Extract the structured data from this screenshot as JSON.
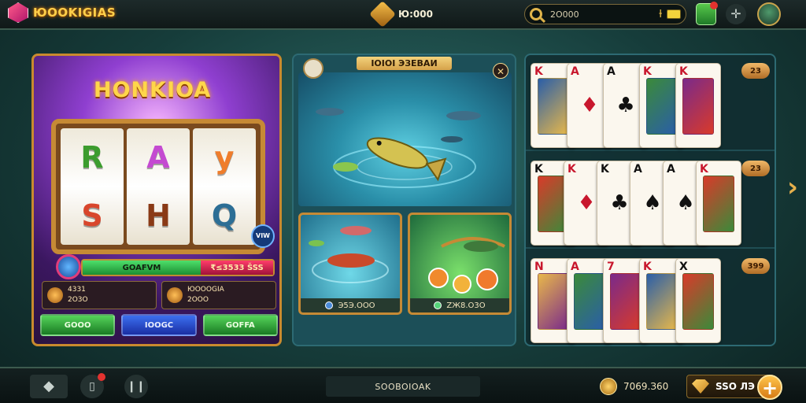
{
  "topbar": {
    "logo_text": "ЮOOKIGIAS",
    "jackpot_value": "Ю:000",
    "search_value": "2O000",
    "flag_glyph": "ƚ"
  },
  "slot": {
    "title": "HONKIOA",
    "reels": [
      [
        "R",
        "S"
      ],
      [
        "A",
        "H"
      ],
      [
        "y",
        "Q"
      ]
    ],
    "reel_colors": [
      "#3c9c2e",
      "#d8462c",
      "#c44ad1",
      "#8a3a16",
      "#ef7d2b",
      "#2c6e95"
    ],
    "badge": "VIW",
    "balance_left": "GOAFVM",
    "balance_right": "₹≤3533 ŠSS",
    "stats": [
      {
        "line1": "4331",
        "line2": "2O3O"
      },
      {
        "line1": "ЮOOOGIA",
        "line2": "2OOO"
      }
    ],
    "buttons": [
      "GOOO",
      "IOOGC",
      "GOFFA"
    ]
  },
  "fishing": {
    "title": "IOIOI ЭЗЕВАИ",
    "card_left_value": "Э5Э.OOO",
    "card_right_value": "ZЖ8.O3O"
  },
  "cards": {
    "row_badges": [
      "23",
      "23",
      "399"
    ],
    "rows": [
      [
        {
          "rank": "K",
          "suit": "♠",
          "color": "red",
          "face": true
        },
        {
          "rank": "A",
          "suit": "♦",
          "color": "red",
          "face": false
        },
        {
          "rank": "A",
          "suit": "♣",
          "color": "black",
          "face": false
        },
        {
          "rank": "K",
          "suit": "♦",
          "color": "red",
          "face": true
        },
        {
          "rank": "K",
          "suit": "♦",
          "color": "red",
          "face": true
        }
      ],
      [
        {
          "rank": "K",
          "suit": "♠",
          "color": "black",
          "face": true
        },
        {
          "rank": "K",
          "suit": "♦",
          "color": "red",
          "face": false
        },
        {
          "rank": "K",
          "suit": "♣",
          "color": "black",
          "face": false
        },
        {
          "rank": "A",
          "suit": "♠",
          "color": "black",
          "face": false
        },
        {
          "rank": "A",
          "suit": "♠",
          "color": "black",
          "face": false
        },
        {
          "rank": "K",
          "suit": "♦",
          "color": "red",
          "face": true
        }
      ],
      [
        {
          "rank": "N",
          "suit": "♦",
          "color": "red",
          "face": true
        },
        {
          "rank": "A",
          "suit": "♦",
          "color": "red",
          "face": true
        },
        {
          "rank": "7",
          "suit": "♦",
          "color": "red",
          "face": true
        },
        {
          "rank": "K",
          "suit": "♦",
          "color": "red",
          "face": true
        },
        {
          "rank": "X",
          "suit": "♠",
          "color": "black",
          "face": true
        }
      ]
    ]
  },
  "bottombar": {
    "center_label": "SOOBOIOAK",
    "coins": "7069.З60",
    "gems": "SSO ЛЭ"
  },
  "colors": {
    "accent_gold": "#c98a2e",
    "green": "#1b8e32",
    "blue": "#1a2ea3"
  }
}
